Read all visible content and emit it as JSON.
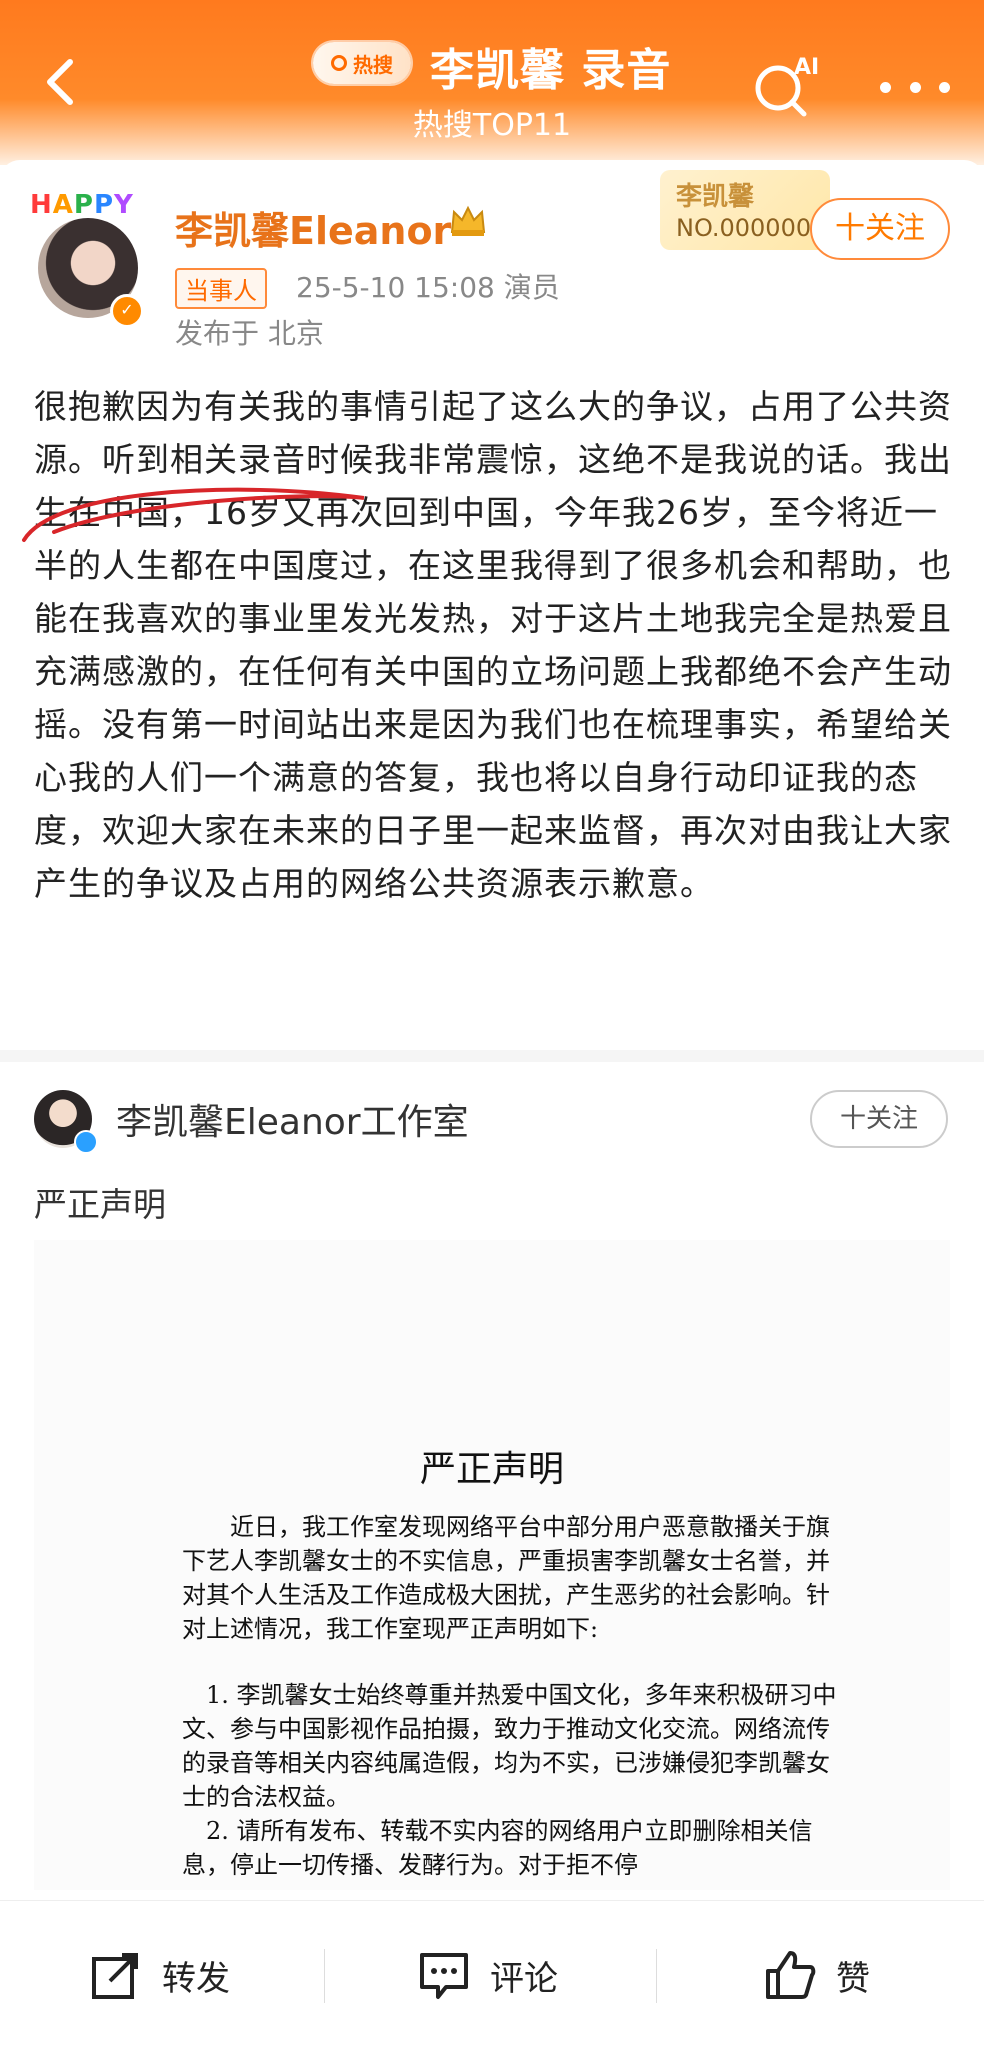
{
  "header": {
    "hot_label": "热搜",
    "title": "李凯馨 录音",
    "subtitle": "热搜TOP11",
    "ai_label": "AI"
  },
  "post": {
    "happy_badge": "HAPPY",
    "username": "李凯馨Eleanor",
    "tag": "当事人",
    "meta": "25-5-10 15:08  演员",
    "location": "发布于 北京",
    "fan_card_name": "李凯馨",
    "fan_card_number": "NO.000000",
    "follow_label": "十关注",
    "text": "很抱歉因为有关我的事情引起了这么大的争议，占用了公共资源。听到相关录音时候我非常震惊，这绝不是我说的话。我出生在中国，16岁又再次回到中国，今年我26岁，至今将近一半的人生都在中国度过，在这里我得到了很多机会和帮助，也能在我喜欢的事业里发光发热，对于这片土地我完全是热爱且充满感激的，在任何有关中国的立场问题上我都绝不会产生动摇。没有第一时间站出来是因为我们也在梳理事实，希望给关心我的人们一个满意的答复，我也将以自身行动印证我的态度，欢迎大家在未来的日子里一起来监督，再次对由我让大家产生的争议及占用的网络公共资源表示歉意。"
  },
  "repost": {
    "username": "李凯馨Eleanor工作室",
    "follow_label": "十关注",
    "text": "严正声明",
    "doc_title": "严正声明",
    "doc_paragraphs": [
      "近日，我工作室发现网络平台中部分用户恶意散播关于旗下艺人李凯馨女士的不实信息，严重损害李凯馨女士名誉，并对其个人生活及工作造成极大困扰，产生恶劣的社会影响。针对上述情况，我工作室现严正声明如下:",
      "1. 李凯馨女士始终尊重并热爱中国文化，多年来积极研习中文、参与中国影视作品拍摄，致力于推动文化交流。网络流传的录音等相关内容纯属造假，均为不实，已涉嫌侵犯李凯馨女士的合法权益。",
      "2. 请所有发布、转载不实内容的网络用户立即删除相关信息，停止一切传播、发酵行为。对于拒不停"
    ]
  },
  "bottom_bar": {
    "repost": "转发",
    "comment": "评论",
    "like": "赞"
  },
  "colors": {
    "header_orange": "#ff7a1e",
    "username_orange": "#e8731a",
    "annotation_red": "#d8262a"
  }
}
